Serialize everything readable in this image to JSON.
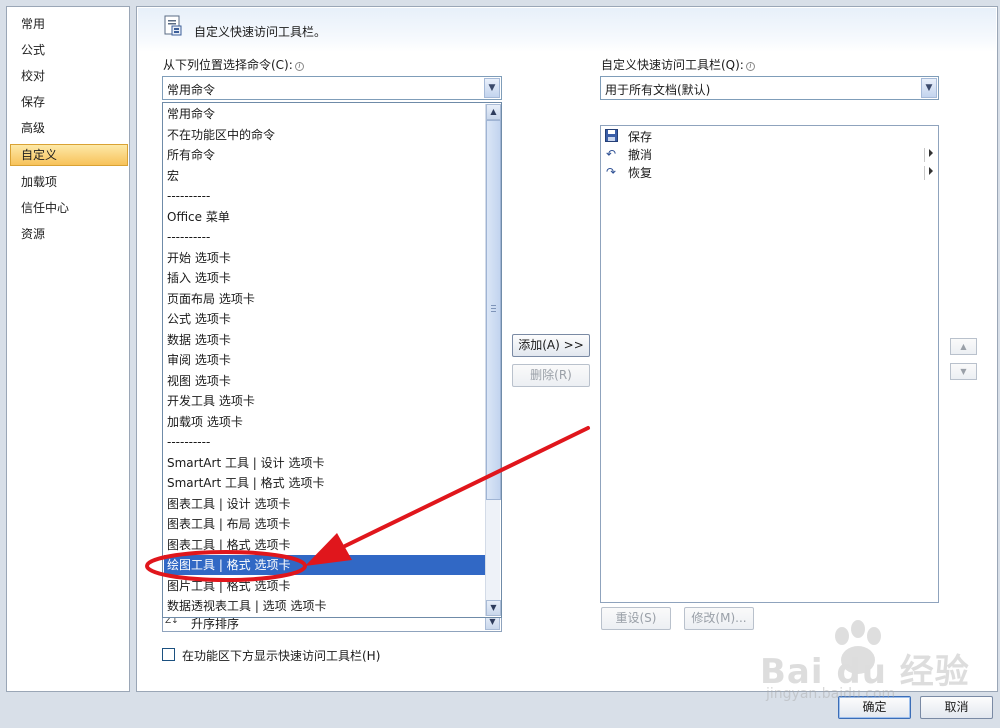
{
  "nav": {
    "items": [
      "常用",
      "公式",
      "校对",
      "保存",
      "高级",
      "自定义",
      "加载项",
      "信任中心",
      "资源"
    ],
    "active_index": 5
  },
  "header": {
    "title": "自定义快速访问工具栏。"
  },
  "left_panel": {
    "label": "从下列位置选择命令(C):",
    "combo_value": "常用命令",
    "dropdown_items": [
      "常用命令",
      "不在功能区中的命令",
      "所有命令",
      "宏",
      "----------",
      "Office 菜单",
      "----------",
      "开始 选项卡",
      "插入 选项卡",
      "页面布局 选项卡",
      "公式 选项卡",
      "数据 选项卡",
      "审阅 选项卡",
      "视图 选项卡",
      "开发工具 选项卡",
      "加载项 选项卡",
      "----------",
      "SmartArt 工具 | 设计 选项卡",
      "SmartArt 工具 | 格式 选项卡",
      "图表工具 | 设计 选项卡",
      "图表工具 | 布局 选项卡",
      "图表工具 | 格式 选项卡",
      "绘图工具 | 格式 选项卡",
      "图片工具 | 格式 选项卡",
      "数据透视表工具 | 选项 选项卡"
    ],
    "selected_index": 22,
    "hidden_row_label": "升序排序"
  },
  "right_panel": {
    "label": "自定义快速访问工具栏(Q):",
    "combo_value": "用于所有文档(默认)",
    "items": [
      {
        "icon": "save-icon",
        "label": "保存",
        "has_submenu": false
      },
      {
        "icon": "undo-icon",
        "label": "撤消",
        "has_submenu": true
      },
      {
        "icon": "redo-icon",
        "label": "恢复",
        "has_submenu": true
      }
    ]
  },
  "buttons": {
    "add": "添加(A) >>",
    "remove": "删除(R)",
    "reset": "重设(S)",
    "modify": "修改(M)...",
    "ok": "确定",
    "cancel": "取消"
  },
  "checkbox": {
    "label": "在功能区下方显示快速访问工具栏(H)",
    "checked": false
  },
  "watermark": {
    "brand": "Bai du 经验",
    "url": "jingyan.baidu.com"
  },
  "colors": {
    "selection": "#3168c5",
    "annotation": "#e0161c",
    "nav_active": "#f7c25a"
  }
}
